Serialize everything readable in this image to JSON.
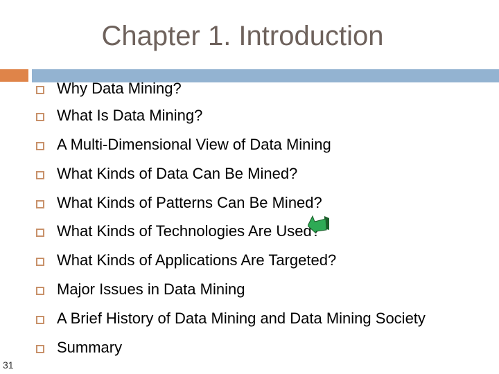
{
  "slide": {
    "title": "Chapter 1.  Introduction",
    "page_number": "31",
    "accent_colors": {
      "orange": "#df8449",
      "blue": "#93b3d1",
      "bullet": "#c8916a"
    },
    "items": [
      {
        "label": "Why Data Mining?"
      },
      {
        "label": "What Is Data Mining?"
      },
      {
        "label": "A Multi-Dimensional View of Data Mining"
      },
      {
        "label": "What Kinds of Data Can Be Mined?"
      },
      {
        "label": "What Kinds of Patterns Can Be Mined?"
      },
      {
        "label": "What Kinds of Technologies Are Used?"
      },
      {
        "label": "What Kinds of Applications Are Targeted?"
      },
      {
        "label": "Major Issues in Data Mining"
      },
      {
        "label": "A Brief History of Data Mining and Data Mining Society"
      },
      {
        "label": "Summary"
      }
    ],
    "pointer_icon": "green-arrow-pointer-icon"
  }
}
